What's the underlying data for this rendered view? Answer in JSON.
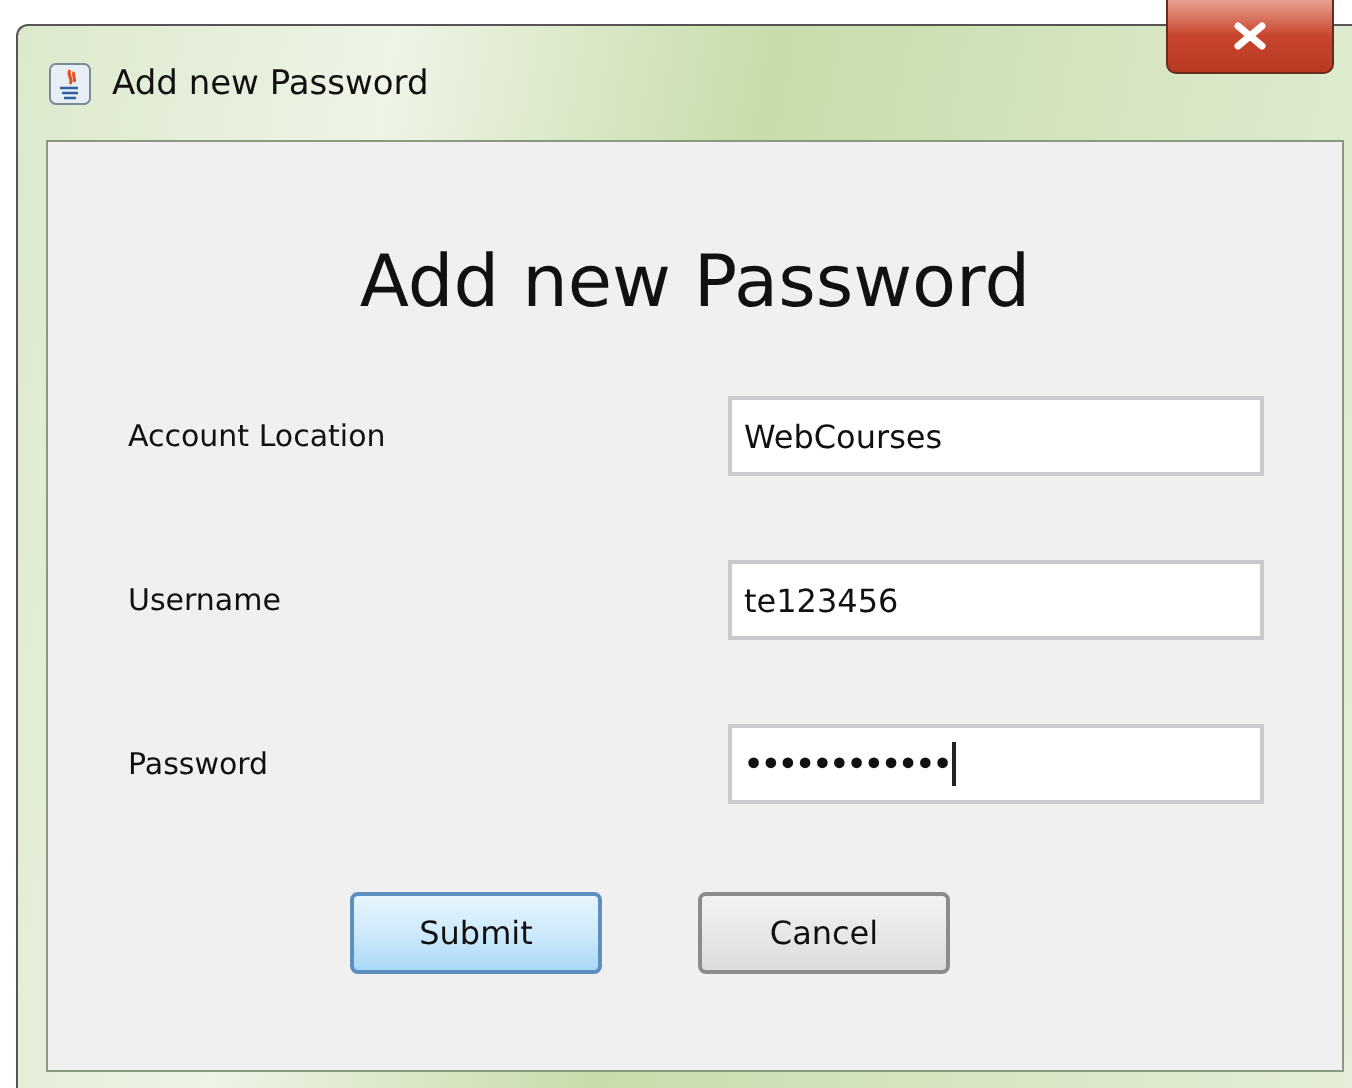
{
  "window": {
    "title": "Add new Password"
  },
  "heading": "Add new Password",
  "fields": [
    {
      "label": "Account Location",
      "value": "WebCourses",
      "masked": false,
      "caret": false
    },
    {
      "label": "Username",
      "value": "te123456",
      "masked": false,
      "caret": false
    },
    {
      "label": "Password",
      "value": "••••••••••••",
      "masked": true,
      "caret": true
    }
  ],
  "buttons": [
    {
      "label": "Submit",
      "focused": true
    },
    {
      "label": "Cancel",
      "focused": false
    }
  ]
}
